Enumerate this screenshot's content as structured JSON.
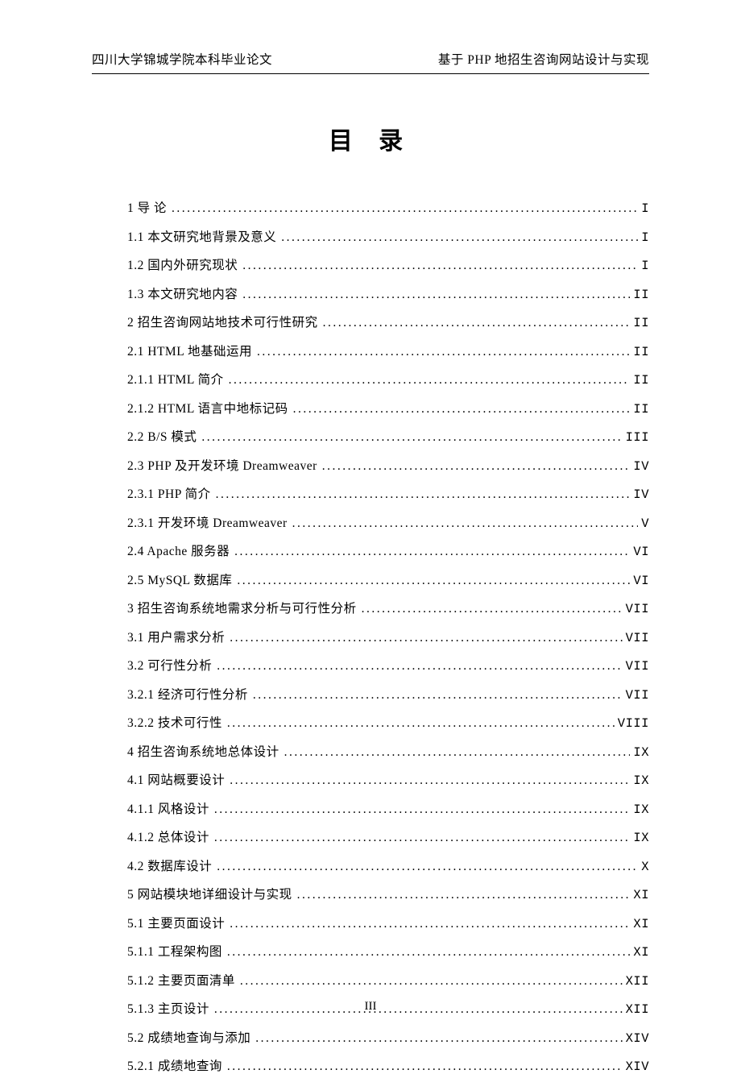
{
  "header": {
    "left": "四川大学锦城学院本科毕业论文",
    "right": "基于 PHP 地招生咨询网站设计与实现"
  },
  "title": "目  录",
  "footer": "III",
  "toc": [
    {
      "label": "1 导 论 ",
      "page": "I"
    },
    {
      "label": "1.1 本文研究地背景及意义 ",
      "page": "I"
    },
    {
      "label": "1.2 国内外研究现状 ",
      "page": "I"
    },
    {
      "label": "1.3 本文研究地内容 ",
      "page": "II"
    },
    {
      "label": "2 招生咨询网站地技术可行性研究 ",
      "page": "II"
    },
    {
      "label": "2.1 HTML 地基础运用",
      "page": "II"
    },
    {
      "label": "2.1.1 HTML 简介",
      "page": "II"
    },
    {
      "label": "2.1.2 HTML 语言中地标记码",
      "page": "II"
    },
    {
      "label": "2.2 B/S 模式",
      "page": "III"
    },
    {
      "label": "2.3 PHP 及开发环境 Dreamweaver ",
      "page": "IV"
    },
    {
      "label": "2.3.1 PHP 简介",
      "page": "IV"
    },
    {
      "label": "2.3.1 开发环境 Dreamweaver",
      "page": "V"
    },
    {
      "label": "2.4 Apache 服务器",
      "page": "VI"
    },
    {
      "label": "2.5 MySQL 数据库",
      "page": "VI"
    },
    {
      "label": "3 招生咨询系统地需求分析与可行性分析 ",
      "page": "VII"
    },
    {
      "label": "3.1 用户需求分析 ",
      "page": "VII"
    },
    {
      "label": "3.2 可行性分析 ",
      "page": "VII"
    },
    {
      "label": "3.2.1 经济可行性分析 ",
      "page": "VII"
    },
    {
      "label": "3.2.2 技术可行性 ",
      "page": "VIII"
    },
    {
      "label": "4 招生咨询系统地总体设计 ",
      "page": "IX"
    },
    {
      "label": "4.1 网站概要设计 ",
      "page": "IX"
    },
    {
      "label": "4.1.1 风格设计 ",
      "page": "IX"
    },
    {
      "label": "4.1.2 总体设计 ",
      "page": "IX"
    },
    {
      "label": "4.2 数据库设计 ",
      "page": "X"
    },
    {
      "label": "5 网站模块地详细设计与实现 ",
      "page": "XI"
    },
    {
      "label": "5.1 主要页面设计 ",
      "page": "XI"
    },
    {
      "label": "5.1.1 工程架构图",
      "page": "XI"
    },
    {
      "label": "5.1.2 主要页面清单",
      "page": "XII"
    },
    {
      "label": "5.1.3 主页设计",
      "page": "XII"
    },
    {
      "label": "5.2 成绩地查询与添加 ",
      "page": "XIV"
    },
    {
      "label": "5.2.1 成绩地查询",
      "page": "XIV"
    }
  ]
}
